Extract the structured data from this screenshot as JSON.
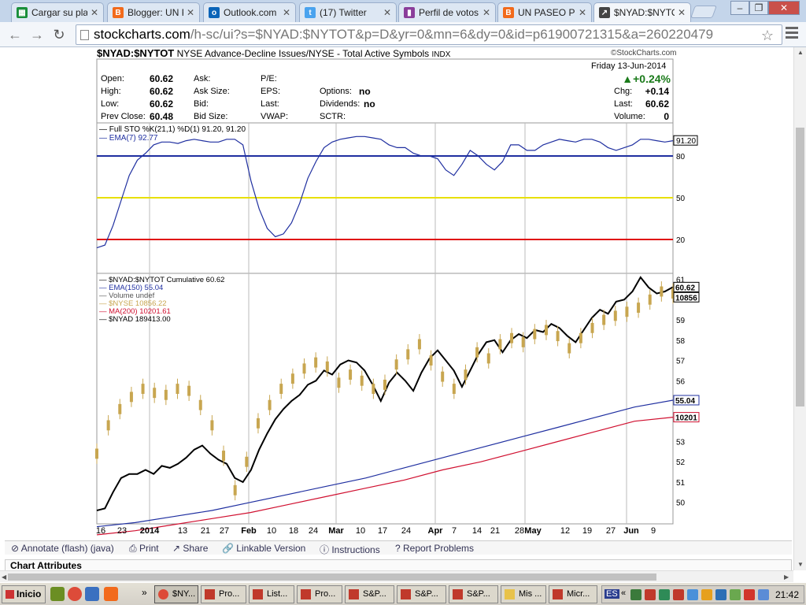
{
  "tabs": [
    {
      "label": "Cargar su plat",
      "icon": "spreadsheet-icon",
      "color": "#1a8f3a"
    },
    {
      "label": "Blogger: UN P",
      "icon": "blogger-icon",
      "color": "#f26a1b"
    },
    {
      "label": "Outlook.com -",
      "icon": "outlook-icon",
      "color": "#0a64b8"
    },
    {
      "label": "(17) Twitter",
      "icon": "twitter-icon",
      "color": "#4aa3ee"
    },
    {
      "label": "Perfil de votos",
      "icon": "profile-icon",
      "color": "#8a3d9a"
    },
    {
      "label": "UN PASEO PO",
      "icon": "blogger-icon",
      "color": "#f26a1b"
    },
    {
      "label": "$NYAD:$NYTO",
      "icon": "stockcharts-icon",
      "color": "#444444"
    }
  ],
  "url": {
    "host": "stockcharts.com",
    "path": "/h-sc/ui?s=$NYAD:$NYTOT&p=D&yr=0&mn=6&dy=0&id=p61900721315&a=260220479"
  },
  "chart": {
    "symbol": "$NYAD:$NYTOT",
    "name": "NYSE Advance-Decline Issues/NYSE - Total Active Symbols",
    "index_tag": "INDX",
    "logo": "©StockCharts.com",
    "date": "Friday  13-Jun-2014",
    "change_pct": "+0.24%",
    "quote": {
      "open_label": "Open:",
      "open": "60.62",
      "high_label": "High:",
      "high": "60.62",
      "low_label": "Low:",
      "low": "60.62",
      "prevclose_label": "Prev Close:",
      "prevclose": "60.48",
      "ask_label": "Ask:",
      "asksize_label": "Ask Size:",
      "bid_label": "Bid:",
      "bidsize_label": "Bid Size:",
      "pe_label": "P/E:",
      "eps_label": "EPS:",
      "last_label": "Last:",
      "vwap_label": "VWAP:",
      "options_label": "Options:",
      "options": "no",
      "dividends_label": "Dividends:",
      "dividends": "no",
      "sctr_label": "SCTR:",
      "chg_label": "Chg:",
      "chg": "+0.14",
      "last2_label": "Last:",
      "last2": "60.62",
      "volume_label": "Volume:",
      "volume": "0"
    }
  },
  "chart_data": [
    {
      "type": "line",
      "legend": [
        "Full STO %K(21,1) %D(1) 91.20, 91.20",
        "EMA(7) 92.77"
      ],
      "y_ticks": [
        "80",
        "50",
        "20"
      ],
      "reference_lines": [
        {
          "value": 80,
          "color": "#1f2fa0"
        },
        {
          "value": 50,
          "color": "#e8e000"
        },
        {
          "value": 20,
          "color": "#e01010"
        }
      ],
      "last_value_label": "91.20",
      "series": [
        {
          "values": [
            14,
            16,
            30,
            48,
            66,
            77,
            82,
            88,
            90,
            90,
            89,
            91,
            92,
            91,
            90,
            90,
            92,
            92,
            88,
            62,
            42,
            28,
            22,
            24,
            32,
            46,
            64,
            76,
            86,
            90,
            92,
            93,
            94,
            94,
            93,
            92,
            88,
            86,
            86,
            82,
            80,
            80,
            78,
            70,
            66,
            74,
            84,
            80,
            74,
            70,
            76,
            88,
            88,
            84,
            84,
            88,
            90,
            92,
            91,
            90,
            92,
            92,
            90,
            86,
            84,
            86,
            88,
            92,
            92,
            91,
            90,
            91
          ],
          "color": "#1f2fa0"
        }
      ]
    },
    {
      "type": "line",
      "legend": [
        "$NYAD:$NYTOT Cumulative 60.62",
        "EMA(150) 55.04",
        "Volume undef",
        "$NYSE 10856.22",
        "MA(200) 10201.61",
        "$NYAD 189413.00"
      ],
      "x_ticks": [
        "16",
        "23",
        "2014",
        "13",
        "21",
        "27",
        "Feb",
        "10",
        "18",
        "24",
        "Mar",
        "10",
        "17",
        "24",
        "Apr",
        "7",
        "14",
        "21",
        "28",
        "May",
        "12",
        "19",
        "27",
        "Jun",
        "9"
      ],
      "y_ticks": [
        "61",
        "59",
        "58",
        "57",
        "56",
        "53",
        "52",
        "51",
        "50"
      ],
      "ylim": [
        49.6,
        61.1
      ],
      "value_labels": [
        "60.62",
        "10856",
        "55.04",
        "10201"
      ],
      "series": [
        {
          "name": "$NYAD:$NYTOT Cumulative",
          "color": "#000000",
          "values": [
            49.6,
            49.7,
            50.5,
            51.2,
            51.4,
            51.4,
            51.6,
            51.4,
            51.8,
            51.7,
            51.9,
            52.2,
            52.6,
            52.8,
            52.4,
            52.1,
            51.9,
            51.2,
            51.0,
            51.6,
            52.6,
            53.4,
            54.1,
            54.6,
            55.0,
            55.3,
            55.8,
            56.0,
            56.5,
            56.3,
            56.8,
            57.0,
            56.9,
            56.5,
            55.8,
            55.0,
            55.9,
            56.4,
            56.0,
            55.5,
            56.4,
            57.1,
            57.5,
            57.0,
            56.5,
            55.7,
            56.5,
            57.3,
            57.9,
            58.0,
            57.4,
            58.0,
            58.3,
            58.1,
            58.5,
            58.4,
            58.8,
            58.6,
            58.2,
            57.9,
            58.5,
            59.1,
            59.5,
            59.3,
            59.9,
            60.0,
            60.4,
            61.1,
            60.6,
            60.3,
            60.4,
            60.62
          ],
          "stroke_width": 2
        },
        {
          "name": "EMA(150)",
          "color": "#1f2fa0",
          "values": [
            48.8,
            49.0,
            49.3,
            49.6,
            50.0,
            50.4,
            50.8,
            51.2,
            51.7,
            52.2,
            52.7,
            53.2,
            53.7,
            54.2,
            54.7,
            55.04
          ]
        },
        {
          "name": "MA(200)",
          "color": "#d01030",
          "values": [
            48.4,
            48.6,
            48.9,
            49.2,
            49.5,
            49.9,
            50.3,
            50.7,
            51.1,
            51.6,
            52.0,
            52.5,
            53.0,
            53.5,
            54.0,
            54.2
          ]
        },
        {
          "name": "$NYSE",
          "color": "#c8a650",
          "values": [
            52.4,
            53.8,
            54.6,
            55.2,
            55.6,
            55.4,
            55.3,
            55.6,
            55.5,
            54.8,
            53.8,
            52.3,
            50.6,
            52.0,
            53.9,
            54.8,
            55.6,
            56.1,
            56.6,
            56.9,
            56.7,
            55.9,
            56.3,
            56.0,
            55.6,
            55.8,
            56.8,
            57.3,
            57.8,
            57.0,
            56.2,
            55.6,
            56.3,
            57.4,
            57.1,
            57.8,
            58.1,
            57.9,
            58.3,
            58.5,
            58.2,
            57.6,
            58.1,
            58.6,
            59.0,
            59.2,
            59.4,
            59.6,
            60.0,
            60.4,
            60.3
          ]
        }
      ]
    }
  ],
  "bottom_links": {
    "annotate": "Annotate (flash) (java)",
    "print": "Print",
    "share": "Share",
    "linkable": "Linkable Version",
    "instructions": "Instructions",
    "report": "Report Problems"
  },
  "chart_attributes": "Chart Attributes",
  "taskbar": {
    "start": "Inicio",
    "items": [
      {
        "label": "$NY...",
        "active": true
      },
      {
        "label": "Pro..."
      },
      {
        "label": "List..."
      },
      {
        "label": "Pro..."
      },
      {
        "label": "S&P..."
      },
      {
        "label": "S&P..."
      },
      {
        "label": "S&P..."
      },
      {
        "label": "Mis ..."
      },
      {
        "label": "Micr..."
      }
    ],
    "tray_lang": "ES",
    "clock": "21:42"
  }
}
